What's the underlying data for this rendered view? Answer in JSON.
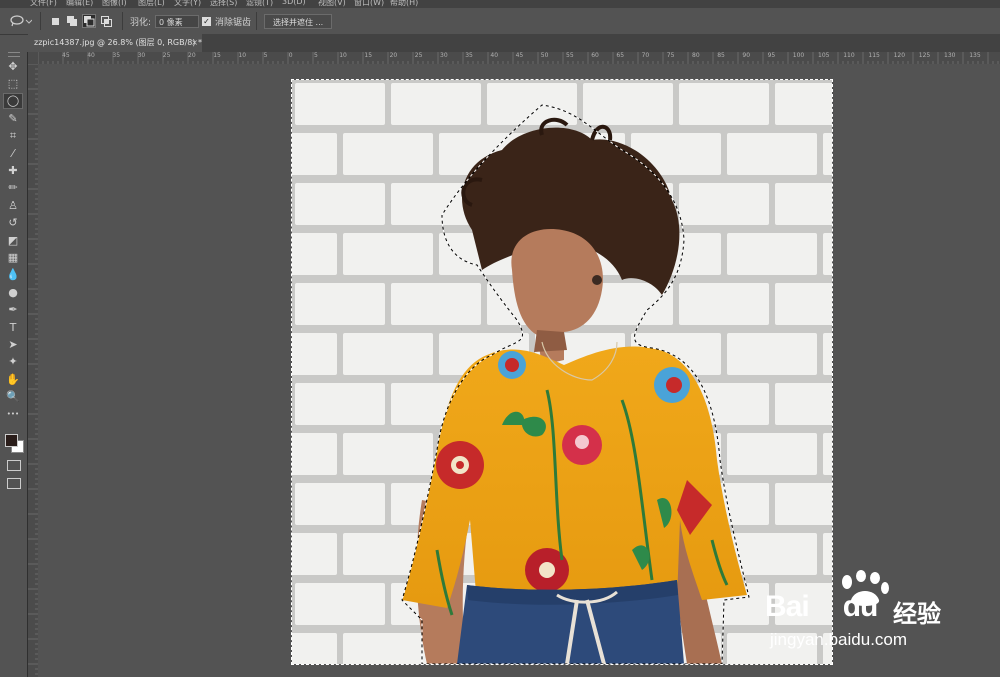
{
  "menu": {
    "items": [
      "文件(F)",
      "编辑(E)",
      "图像(I)",
      "图层(L)",
      "文字(Y)",
      "选择(S)",
      "滤镜(T)",
      "3D(D)",
      "视图(V)",
      "窗口(W)",
      "帮助(H)"
    ]
  },
  "options": {
    "feather_label": "羽化:",
    "feather_value": "0 像素",
    "antialias_label": "消除锯齿",
    "antialias_checked": "✓",
    "select_mask_label": "选择并遮住 ..."
  },
  "document": {
    "tab_title": "zzpic14387.jpg @ 26.8% (图层 0, RGB/8) *",
    "close_glyph": "×"
  },
  "ruler": {
    "h_ticks": [
      "45",
      "40",
      "35",
      "30",
      "25",
      "20",
      "15",
      "10",
      "5",
      "0",
      "5",
      "10",
      "15",
      "20",
      "25",
      "30",
      "35",
      "40",
      "45",
      "50",
      "55",
      "60",
      "65",
      "70",
      "75",
      "80",
      "85",
      "90",
      "95",
      "100",
      "105",
      "110",
      "115",
      "120",
      "125",
      "130",
      "135"
    ]
  },
  "tools": [
    {
      "name": "move-tool",
      "glyph": "✥"
    },
    {
      "name": "marquee-tool",
      "glyph": "⬚"
    },
    {
      "name": "lasso-tool",
      "glyph": "◯"
    },
    {
      "name": "quick-select-tool",
      "glyph": "✎"
    },
    {
      "name": "crop-tool",
      "glyph": "⌗"
    },
    {
      "name": "eyedropper-tool",
      "glyph": "⁄"
    },
    {
      "name": "healing-brush-tool",
      "glyph": "✚"
    },
    {
      "name": "brush-tool",
      "glyph": "✏"
    },
    {
      "name": "clone-stamp-tool",
      "glyph": "♙"
    },
    {
      "name": "history-brush-tool",
      "glyph": "↺"
    },
    {
      "name": "eraser-tool",
      "glyph": "◩"
    },
    {
      "name": "gradient-tool",
      "glyph": "▦"
    },
    {
      "name": "blur-tool",
      "glyph": "💧"
    },
    {
      "name": "dodge-tool",
      "glyph": "●"
    },
    {
      "name": "pen-tool",
      "glyph": "✒"
    },
    {
      "name": "type-tool",
      "glyph": "T"
    },
    {
      "name": "path-select-tool",
      "glyph": "➤"
    },
    {
      "name": "shape-tool",
      "glyph": "✦"
    },
    {
      "name": "hand-tool",
      "glyph": "✋"
    },
    {
      "name": "zoom-tool",
      "glyph": "🔍"
    },
    {
      "name": "more-tools",
      "glyph": "•••"
    }
  ],
  "colors": {
    "foreground": "#2a1d1a",
    "background": "#ffffff",
    "ui_bg": "#535353"
  },
  "watermark": {
    "brand": "Bai",
    "brand_suffix": "du",
    "chinese": "经验",
    "url": "jingyan.baidu.com"
  }
}
